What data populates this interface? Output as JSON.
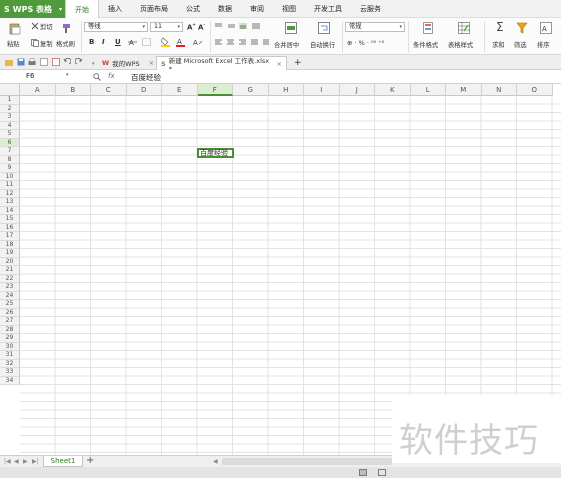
{
  "app": {
    "name": "WPS 表格"
  },
  "menu": {
    "tabs": [
      "开始",
      "插入",
      "页面布局",
      "公式",
      "数据",
      "审阅",
      "视图",
      "开发工具",
      "云服务"
    ],
    "active": "开始"
  },
  "ribbon": {
    "clipboard": {
      "paste": "粘贴",
      "cut": "剪切",
      "copy": "复制",
      "format_painter": "格式刷"
    },
    "font": {
      "name": "等线",
      "size": "11",
      "bold": "B",
      "italic": "I",
      "underline": "U"
    },
    "align": {
      "merge_center": "合并居中",
      "wrap": "自动换行"
    },
    "number": {
      "format": "常规"
    },
    "styles": {
      "conditional": "条件格式",
      "table_style": "表格样式"
    },
    "editing": {
      "sum": "求和",
      "filter": "筛选",
      "sort": "排序"
    }
  },
  "tabs": {
    "home": "我的WPS",
    "document": "新建 Microsoft Excel 工作表.xlsx *",
    "new_tab": "+"
  },
  "formula_bar": {
    "name_box": "F6",
    "fx": "fx",
    "value": "百度经验"
  },
  "grid": {
    "columns": [
      "A",
      "B",
      "C",
      "D",
      "E",
      "F",
      "G",
      "H",
      "I",
      "J",
      "K",
      "L",
      "M",
      "N",
      "O"
    ],
    "selected_column": "F",
    "rows": [
      "1",
      "2",
      "3",
      "4",
      "5",
      "6",
      "7",
      "8",
      "9",
      "10",
      "11",
      "12",
      "13",
      "14",
      "15",
      "16",
      "17",
      "18",
      "19",
      "20",
      "21",
      "22",
      "23",
      "24",
      "25",
      "26",
      "27",
      "28",
      "29",
      "30",
      "31",
      "32",
      "33",
      "34"
    ],
    "selected_row": "6",
    "active_cell_value": "百度经验"
  },
  "sheets": {
    "tabs": [
      "Sheet1"
    ],
    "active": "Sheet1",
    "add": "+"
  },
  "watermark": {
    "text": "软件技巧"
  },
  "colors": {
    "accent": "#4f9b3b",
    "selection": "#dcedd4"
  }
}
